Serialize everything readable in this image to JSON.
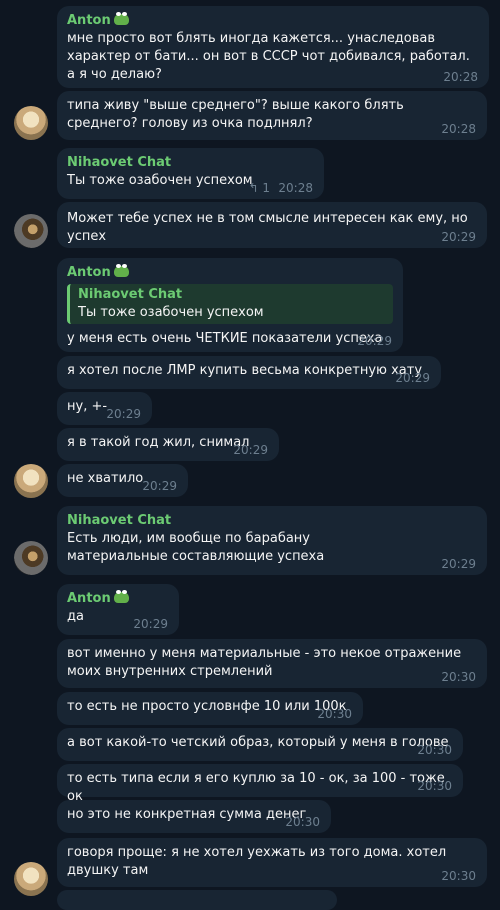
{
  "messages": [
    {
      "sender": "Anton",
      "text": "мне просто вот блять иногда кажется... унаследовав характер от бати... он вот в СССР  чот добивался, работал. а я чо делаю?",
      "time": "20:28"
    },
    {
      "text": "типа живу \"выше среднего\"? выше какого блять среднего? голову из очка подлнял?",
      "time": "20:28"
    },
    {
      "sender": "Nihaovet Chat",
      "text": "Ты тоже озабочен успехом",
      "time": "20:28",
      "replies": "1"
    },
    {
      "text": "Может тебе успех не в том смысле интересен как ему, но успех",
      "time": "20:29"
    },
    {
      "sender": "Anton",
      "quote_name": "Nihaovet Chat",
      "quote_text": "Ты тоже озабочен успехом",
      "text": "у меня есть очень ЧЕТКИЕ показатели успеха",
      "time": "20:29"
    },
    {
      "text": "я хотел после ЛМР купить весьма конкретную хату",
      "time": "20:29"
    },
    {
      "text": "ну, +-",
      "time": "20:29"
    },
    {
      "text": "я в такой год жил, снимал",
      "time": "20:29"
    },
    {
      "text": "не хватило",
      "time": "20:29"
    },
    {
      "sender": "Nihaovet Chat",
      "text": "Есть люди, им вообще по барабану материальные составляющие успеха",
      "time": "20:29"
    },
    {
      "sender": "Anton",
      "text": "да",
      "time": "20:29"
    },
    {
      "text": "вот именно у меня материальные - это некое отражение моих внутренних стремлений",
      "time": "20:30"
    },
    {
      "text": "то есть не просто условнфе 10 или 100к",
      "time": "20:30"
    },
    {
      "text": "а вот какой-то четский образ, который у меня в голове",
      "time": "20:30"
    },
    {
      "text": "то есть типа если я его куплю за 10 - ок, за 100 - тоже ок",
      "time": "20:30"
    },
    {
      "text": "но это не конкретная сумма денег",
      "time": "20:30"
    },
    {
      "text": "говоря проще: я не хотел уехжать из того дома. хотел двушку там",
      "time": "20:30"
    }
  ],
  "icons": {
    "reply": "reply-arrow-icon",
    "emoji": "pepe-frog-emoji"
  },
  "colors": {
    "background": "#0e1621",
    "bubble": "#182533",
    "sender_name": "#6ccb73",
    "time": "#6d7f8f"
  }
}
